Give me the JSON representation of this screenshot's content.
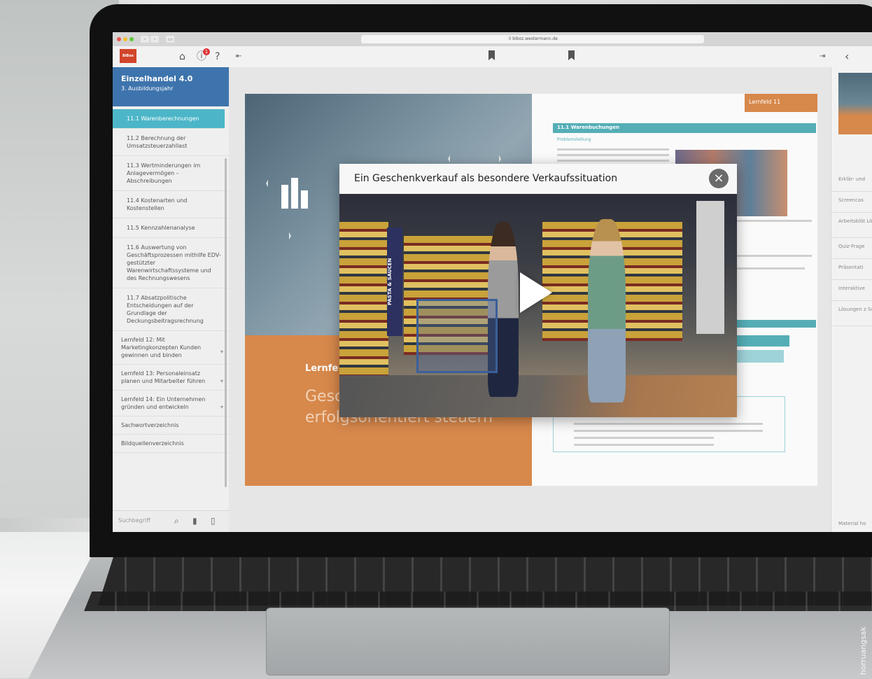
{
  "browser": {
    "url": " li biboz.westermann.de"
  },
  "app": {
    "notification_count": "1",
    "book_title": "Einzelhandel 4.0",
    "book_subtitle": "3. Ausbildungsjahr"
  },
  "sidebar": {
    "sub_items": [
      {
        "label": "11.1 Warenberechnungen",
        "active": true
      },
      {
        "label": "11.2 Berechnung der Umsatzsteuerzahllast",
        "active": false
      },
      {
        "label": "11.3 Wertminderungen im Anlagevermögen – Abschreibungen",
        "active": false
      },
      {
        "label": "11.4 Kostenarten und Kostenstellen",
        "active": false
      },
      {
        "label": "11.5 Kennzahlenanalyse",
        "active": false
      },
      {
        "label": "11.6 Auswertung von Geschäftsprozessen mithilfe EDV-gestützter Warenwirtschaftssysteme und des Rechnungswesens",
        "active": false
      },
      {
        "label": "11.7 Absatzpolitische Entscheidungen auf der Grundlage der Deckungsbeitragsrechnung",
        "active": false
      }
    ],
    "main_items": [
      {
        "label": "Lernfeld 12: Mit Marketingkonzepten Kunden gewinnen und binden"
      },
      {
        "label": "Lernfeld 13: Personaleinsatz planen und Mitarbeiter führen"
      },
      {
        "label": "Lernfeld 14: Ein Unternehmen gründen und entwickeln"
      },
      {
        "label": "Sachwortverzeichnis"
      },
      {
        "label": "Bildquellenverzeichnis"
      }
    ],
    "search_placeholder": "Suchbegriff"
  },
  "page": {
    "left_heading": "Lernfe",
    "left_big_line1": "Gesc",
    "left_big_line2": "erfolgsorientiert steuern",
    "right_tag": "Lernfeld 11",
    "section_bar": "11.1  Warenbuchungen",
    "subhead": "Problemstellung"
  },
  "modal": {
    "title": "Ein Geschenkverkauf als besondere Verkaufssituation",
    "close_icon": "close-icon",
    "sign_text": "PASTA & SAUCEN"
  },
  "right_panel": {
    "items": [
      "Erklär- und",
      "Screencas",
      "Arbeitsblät Lösungen",
      "Quiz-Frage",
      "Präsentati",
      "Interaktive",
      "Lösungen z Schülerban"
    ],
    "footer": "Material ho"
  },
  "credit": "horruangsak",
  "colors": {
    "accent_blue": "#3e74ad",
    "teal": "#4cb6c8",
    "orange": "#d7884b"
  }
}
